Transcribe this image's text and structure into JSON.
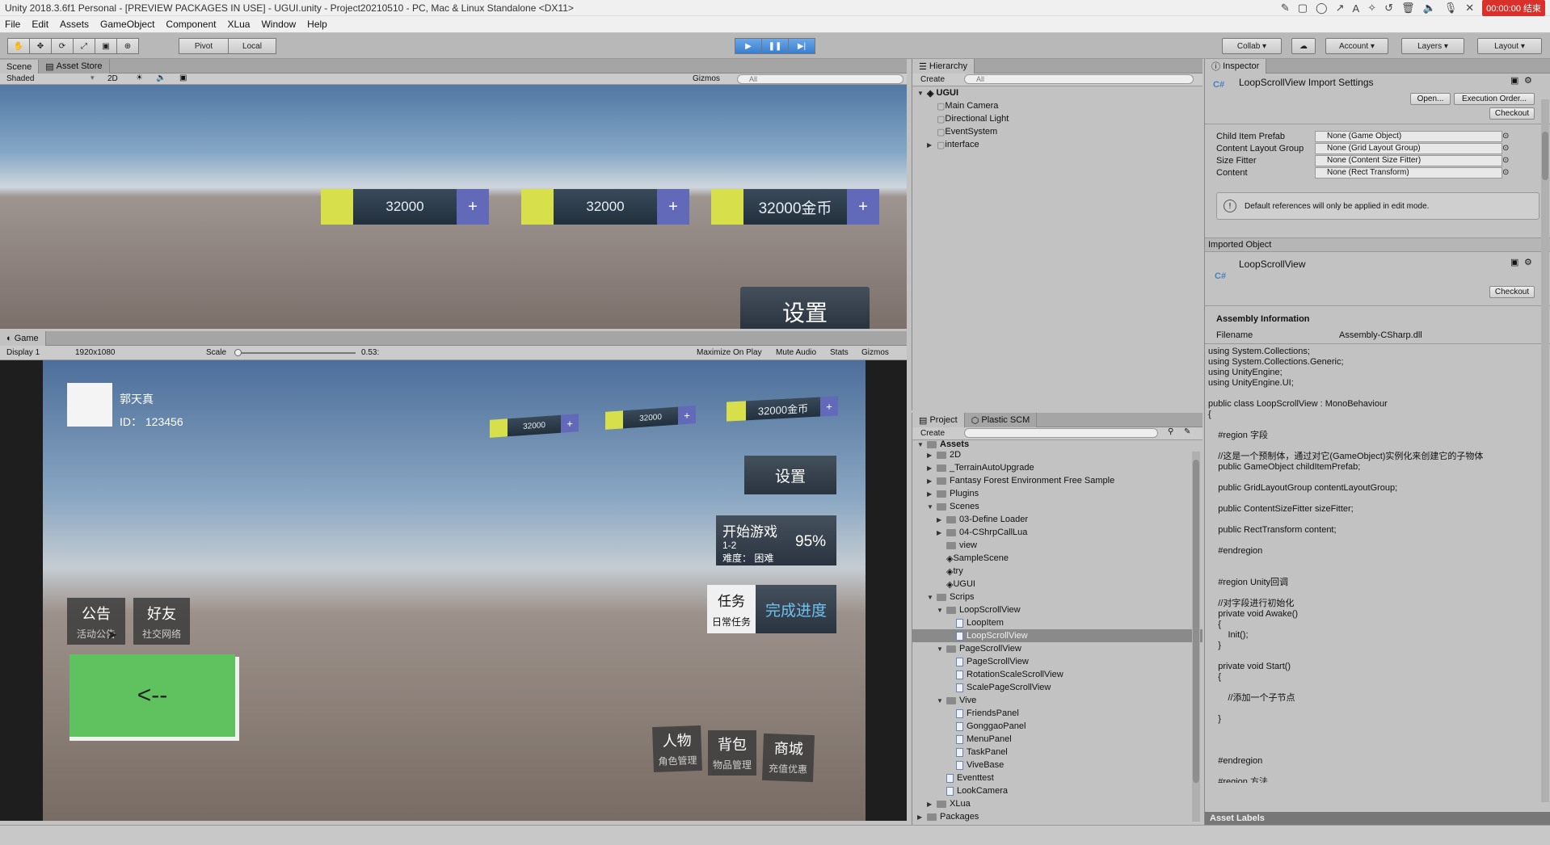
{
  "window": {
    "title": "Unity 2018.3.6f1 Personal - [PREVIEW PACKAGES IN USE] - UGUI.unity - Project20210510 - PC, Mac & Linux Standalone <DX11>",
    "record_label": "00:00:00 结束"
  },
  "menu": [
    "File",
    "Edit",
    "Assets",
    "GameObject",
    "Component",
    "XLua",
    "Window",
    "Help"
  ],
  "toolbar": {
    "pivot": "Pivot",
    "local": "Local",
    "collab": "Collab",
    "account": "Account",
    "layers": "Layers",
    "layout": "Layout"
  },
  "scene": {
    "tab_scene": "Scene",
    "tab_asset_store": "Asset Store",
    "shading": "Shaded",
    "mode_2d": "2D",
    "gizmos": "Gizmos",
    "search_placeholder": "All",
    "coins": [
      "32000",
      "32000",
      "32000金币"
    ],
    "settings_label": "设置"
  },
  "game": {
    "tab": "Game",
    "display": "Display 1",
    "resolution": "1920x1080",
    "scale_label": "Scale",
    "scale_value": "0.53:",
    "maximize": "Maximize On Play",
    "mute": "Mute Audio",
    "stats": "Stats",
    "gizmos": "Gizmos",
    "player_name": "郭天真",
    "player_id": "ID：  123456",
    "coins": [
      "32000",
      "32000",
      "32000金币"
    ],
    "settings": "设置",
    "start": {
      "title": "开始游戏",
      "level": "1-2",
      "difficulty": "难度：  困难",
      "percent": "95%"
    },
    "task": {
      "title": "任务",
      "sub": "日常任务",
      "progress": "完成进度"
    },
    "notice": {
      "title": "公告",
      "sub": "活动公告"
    },
    "friends": {
      "title": "好友",
      "sub": "社交网络"
    },
    "back": "<--",
    "bottom": [
      {
        "title": "人物",
        "sub": "角色管理"
      },
      {
        "title": "背包",
        "sub": "物品管理"
      },
      {
        "title": "商城",
        "sub": "充值优惠"
      }
    ]
  },
  "hierarchy": {
    "tab": "Hierarchy",
    "create": "Create",
    "search_placeholder": "All",
    "scene": "UGUI",
    "items": [
      "Main Camera",
      "Directional Light",
      "EventSystem",
      "interface"
    ]
  },
  "project": {
    "tab": "Project",
    "tab2": "Plastic SCM",
    "create": "Create",
    "root": "Assets",
    "tree": [
      {
        "label": "2D",
        "d": 1,
        "t": "f",
        "e": "c"
      },
      {
        "label": "_TerrainAutoUpgrade",
        "d": 1,
        "t": "f",
        "e": "c"
      },
      {
        "label": "Fantasy Forest Environment Free Sample",
        "d": 1,
        "t": "f",
        "e": "c"
      },
      {
        "label": "Plugins",
        "d": 1,
        "t": "f",
        "e": "c"
      },
      {
        "label": "Scenes",
        "d": 1,
        "t": "f",
        "e": "o"
      },
      {
        "label": "03-Define Loader",
        "d": 2,
        "t": "f",
        "e": "c"
      },
      {
        "label": "04-CShrpCallLua",
        "d": 2,
        "t": "f",
        "e": "c"
      },
      {
        "label": "view",
        "d": 2,
        "t": "f",
        "e": ""
      },
      {
        "label": "SampleScene",
        "d": 2,
        "t": "u",
        "e": ""
      },
      {
        "label": "try",
        "d": 2,
        "t": "u",
        "e": ""
      },
      {
        "label": "UGUI",
        "d": 2,
        "t": "u",
        "e": ""
      },
      {
        "label": "Scrips",
        "d": 1,
        "t": "f",
        "e": "o"
      },
      {
        "label": "LoopScrollView",
        "d": 2,
        "t": "f",
        "e": "o"
      },
      {
        "label": "LoopItem",
        "d": 3,
        "t": "s",
        "e": ""
      },
      {
        "label": "LoopScrollView",
        "d": 3,
        "t": "s",
        "e": "",
        "sel": true
      },
      {
        "label": "PageScrollView",
        "d": 2,
        "t": "f",
        "e": "o"
      },
      {
        "label": "PageScrollView",
        "d": 3,
        "t": "s",
        "e": ""
      },
      {
        "label": "RotationScaleScrollView",
        "d": 3,
        "t": "s",
        "e": ""
      },
      {
        "label": "ScalePageScrollView",
        "d": 3,
        "t": "s",
        "e": ""
      },
      {
        "label": "Vive",
        "d": 2,
        "t": "f",
        "e": "o"
      },
      {
        "label": "FriendsPanel",
        "d": 3,
        "t": "s",
        "e": ""
      },
      {
        "label": "GonggaoPanel",
        "d": 3,
        "t": "s",
        "e": ""
      },
      {
        "label": "MenuPanel",
        "d": 3,
        "t": "s",
        "e": ""
      },
      {
        "label": "TaskPanel",
        "d": 3,
        "t": "s",
        "e": ""
      },
      {
        "label": "ViveBase",
        "d": 3,
        "t": "s",
        "e": ""
      },
      {
        "label": "Eventtest",
        "d": 2,
        "t": "s",
        "e": ""
      },
      {
        "label": "LookCamera",
        "d": 2,
        "t": "s",
        "e": ""
      },
      {
        "label": "XLua",
        "d": 1,
        "t": "f",
        "e": "c"
      },
      {
        "label": "Packages",
        "d": 0,
        "t": "f",
        "e": "c"
      }
    ]
  },
  "inspector": {
    "tab": "Inspector",
    "title": "LoopScrollView Import Settings",
    "cs": "C#",
    "open": "Open...",
    "exec_order": "Execution Order...",
    "checkout": "Checkout",
    "fields": [
      {
        "label": "Child Item Prefab",
        "value": "None (Game Object)"
      },
      {
        "label": "Content Layout Group",
        "value": "None (Grid Layout Group)"
      },
      {
        "label": "Size Fitter",
        "value": "None (Content Size Fitter)"
      },
      {
        "label": "Content",
        "value": "None (Rect Transform)"
      }
    ],
    "info": "Default references will only be applied in edit mode.",
    "imported_object": "Imported Object",
    "imported_name": "LoopScrollView",
    "assembly_info": "Assembly Information",
    "filename_label": "Filename",
    "filename_value": "Assembly-CSharp.dll",
    "code": "using System.Collections;\nusing System.Collections.Generic;\nusing UnityEngine;\nusing UnityEngine.UI;\n\npublic class LoopScrollView : MonoBehaviour\n{\n\n    #region 字段\n\n    //这是一个预制体，通过对它(GameObject)实例化来创建它的子物体\n    public GameObject childItemPrefab;\n\n    public GridLayoutGroup contentLayoutGroup;\n\n    public ContentSizeFitter sizeFitter;\n\n    public RectTransform content;\n\n    #endregion\n\n\n    #region Unity回调\n\n    //对字段进行初始化\n    private void Awake()\n    {\n        Init();\n    }\n\n    private void Start()\n    {\n\n        //添加一个子节点\n\n    }\n\n\n\n    #endregion\n\n    #region 方法",
    "asset_labels": "Asset Labels"
  }
}
